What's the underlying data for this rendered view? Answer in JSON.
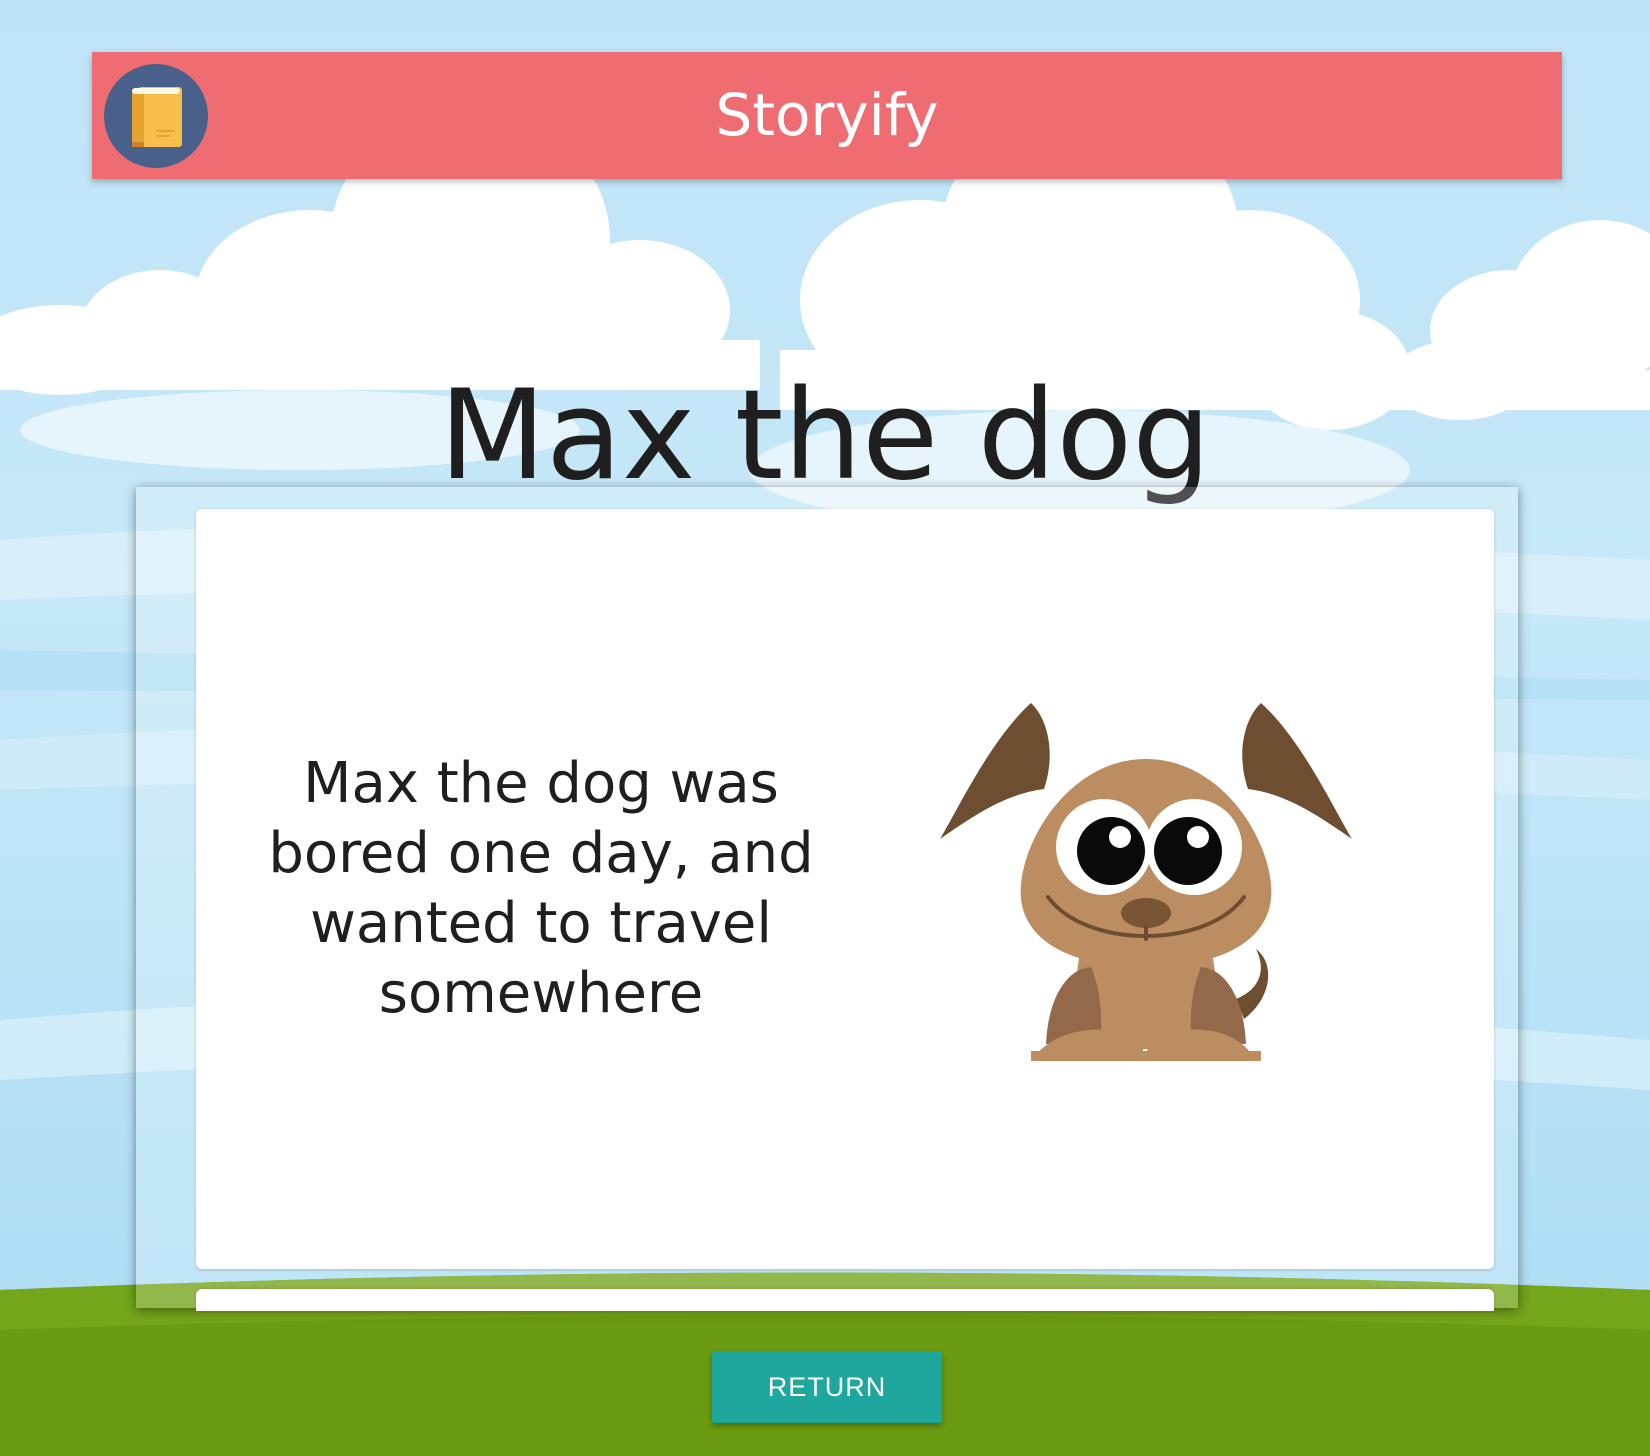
{
  "header": {
    "app_title": "Storyify",
    "logo_icon": "book-icon"
  },
  "story": {
    "title": "Max the dog",
    "page_text": "Max the dog was bored one day, and wanted to travel somewhere",
    "illustration": "dog-illustration"
  },
  "actions": {
    "return_label": "RETURN"
  },
  "colors": {
    "header_bg": "#ef6d72",
    "logo_bg": "#48608a",
    "button_bg": "#1ea79c",
    "grass": "#6a9b12",
    "sky": "#c6e8f8"
  }
}
